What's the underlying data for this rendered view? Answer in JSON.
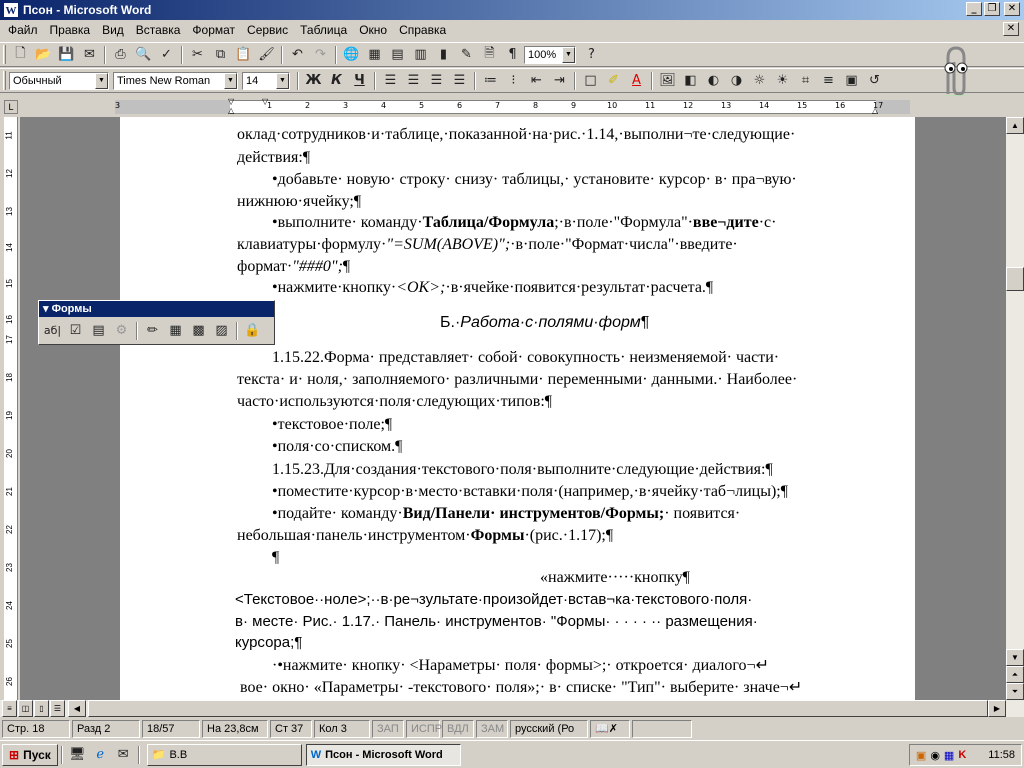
{
  "window": {
    "title": "Псон - Microsoft Word",
    "minimize": "_",
    "restore": "❐",
    "close": "✕"
  },
  "menu": [
    "Файл",
    "Правка",
    "Вид",
    "Вставка",
    "Формат",
    "Сервис",
    "Таблица",
    "Окно",
    "Справка"
  ],
  "toolbar": {
    "zoom": "100%"
  },
  "format": {
    "style": "Обычный",
    "font": "Times New Roman",
    "size": "14",
    "bold": "Ж",
    "italic": "К",
    "underline": "Ч"
  },
  "ruler": {
    "hticks": [
      "3",
      "1",
      "2",
      "3",
      "4",
      "5",
      "6",
      "7",
      "8",
      "9",
      "10",
      "11",
      "12",
      "13",
      "14",
      "15",
      "16",
      "17"
    ],
    "vticks": [
      "11",
      "12",
      "13",
      "14",
      "15",
      "16",
      "17",
      "18",
      "19",
      "20",
      "21",
      "22",
      "23",
      "24",
      "25",
      "26"
    ]
  },
  "forms_toolbar": {
    "title": "Формы",
    "text_field_icon": "аб|"
  },
  "doc": {
    "l1": "оклад·сотрудников·и·таблице,·показанной·на·рис.·1.14,·выполни¬те·следующие·",
    "l2": "действия:¶",
    "l3": "•добавьте· новую· строку· снизу· таблицы,· установите· курсор· в· пра¬вую·",
    "l4": "нижнюю·ячейку;¶",
    "l5a": "•выполните· команду·",
    "l5b": "Таблица/Формула",
    "l5c": ";·в·поле·\"Формула\"·",
    "l5d": "вве¬дите",
    "l5e": "·с·",
    "l6a": "клавиатуры·формулу·",
    "l6b": "\"=SUM(ABOVE)\";",
    "l6c": "·в·поле·\"Формат·числа\"·введите·",
    "l7a": "формат·",
    "l7b": "\"###0\";",
    "l7c": "¶",
    "l8a": "•нажмите·кнопку·",
    "l8b": "<OK>;",
    "l8c": "·в·ячейке·появится·результат·расчета.¶",
    "h1a": "Б.·",
    "h1b": "Работа·с·полями·форм",
    "h1c": "¶",
    "p1": "1.15.22.Форма· представляет· собой· совокупность· неизменяемой· части·",
    "p2": "текста· и· ноля,· заполняемого· различными· переменными· данными.· Наиболее·",
    "p3": "часто·используются·поля·следующих·типов:¶",
    "p4": "•текстовое·поле;¶",
    "p5": "•поля·со·списком.¶",
    "p6": "1.15.23.Для·создания·текстового·поля·выполните·следующие·действия:¶",
    "p7": "•поместите·курсор·в·место·вставки·поля·(например,·в·ячейку·таб¬лицы);¶",
    "p8a": "•подайте· команду·",
    "p8b": "Вид/Панели· инструментов/Формы;",
    "p8c": "· появится·",
    "p9a": "небольшая·панель·инструментом·",
    "p9b": "Формы",
    "p9c": "·(рис.·1.17);¶",
    "p10": "¶",
    "p11": "«нажмите·····кнопку¶",
    "p12": "<Текстовое··ноле>;··в·ре¬зультате·произойдет·встав¬ка·текстового·поля·",
    "p13": "в· месте· Рис.· 1.17.· Панель· инструментов· \"Формы· · · · · ·· размещения·",
    "p14": "курсора;¶",
    "p15": "·•нажмите· кнопку· <Нараметры· поля· формы>;· откроется· диалого¬↵",
    "p16": "вое· окно· «Параметры· -текстового· поля»;· в· списке· \"Тип\"· выберите· значе¬↵"
  },
  "status": {
    "page": "Стр. 18",
    "section": "Разд 2",
    "pages": "18/57",
    "pos": "На 23,8см",
    "line": "Ст 37",
    "col": "Кол 3",
    "rec": "ЗАП",
    "trk": "ИСПР",
    "ext": "ВДЛ",
    "ovr": "ЗАМ",
    "lang": "русский (Ро"
  },
  "taskbar": {
    "start": "Пуск",
    "task1": "B.B",
    "task2": "Псон - Microsoft Word",
    "clock": "11:58"
  }
}
